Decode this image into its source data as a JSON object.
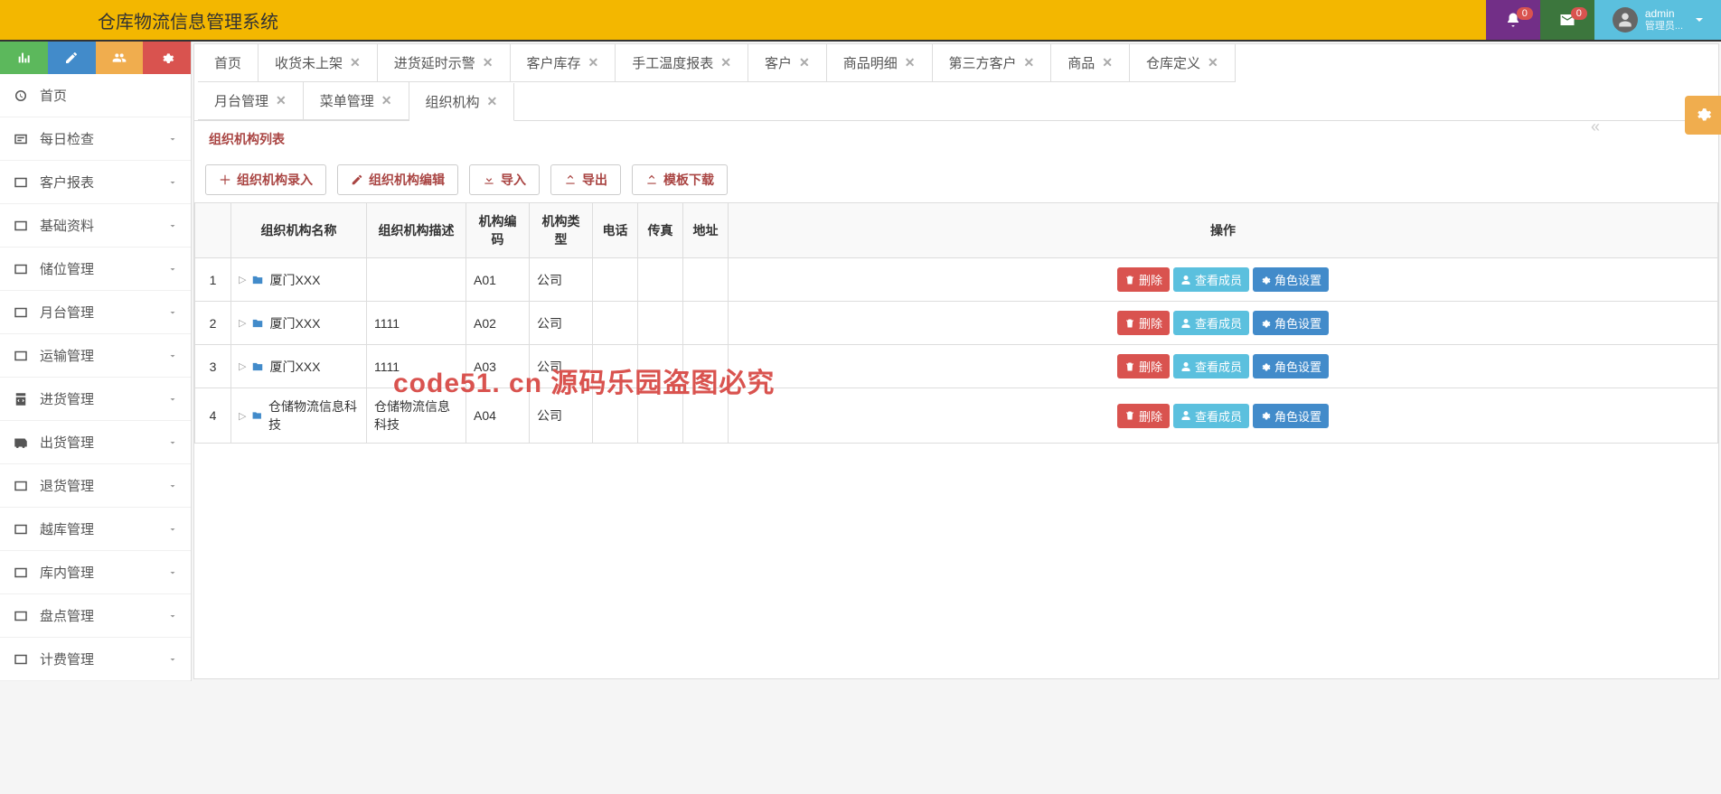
{
  "header": {
    "app_title": "仓库物流信息管理系统",
    "notif_count": "0",
    "mail_count": "0",
    "username": "admin",
    "user_role": "管理员..."
  },
  "sidebar": {
    "items": [
      {
        "label": "首页",
        "has_caret": false
      },
      {
        "label": "每日检查",
        "has_caret": true
      },
      {
        "label": "客户报表",
        "has_caret": true
      },
      {
        "label": "基础资料",
        "has_caret": true
      },
      {
        "label": "储位管理",
        "has_caret": true
      },
      {
        "label": "月台管理",
        "has_caret": true
      },
      {
        "label": "运输管理",
        "has_caret": true
      },
      {
        "label": "进货管理",
        "has_caret": true
      },
      {
        "label": "出货管理",
        "has_caret": true
      },
      {
        "label": "退货管理",
        "has_caret": true
      },
      {
        "label": "越库管理",
        "has_caret": true
      },
      {
        "label": "库内管理",
        "has_caret": true
      },
      {
        "label": "盘点管理",
        "has_caret": true
      },
      {
        "label": "计费管理",
        "has_caret": true
      }
    ]
  },
  "tabs": {
    "row1": [
      {
        "label": "首页",
        "closable": false
      },
      {
        "label": "收货未上架",
        "closable": true
      },
      {
        "label": "进货延时示警",
        "closable": true
      },
      {
        "label": "客户库存",
        "closable": true
      },
      {
        "label": "手工温度报表",
        "closable": true
      },
      {
        "label": "客户",
        "closable": true
      },
      {
        "label": "商品明细",
        "closable": true
      },
      {
        "label": "第三方客户",
        "closable": true
      },
      {
        "label": "商品",
        "closable": true
      },
      {
        "label": "仓库定义",
        "closable": true
      }
    ],
    "row2": [
      {
        "label": "月台管理",
        "closable": true
      },
      {
        "label": "菜单管理",
        "closable": true
      },
      {
        "label": "组织机构",
        "closable": true,
        "active": true
      }
    ]
  },
  "panel": {
    "title": "组织机构列表",
    "actions": {
      "add": "组织机构录入",
      "edit": "组织机构编辑",
      "import": "导入",
      "export": "导出",
      "template": "模板下载"
    },
    "columns": {
      "idx": "",
      "name": "组织机构名称",
      "desc": "组织机构描述",
      "code": "机构编码",
      "type": "机构类型",
      "phone": "电话",
      "fax": "传真",
      "addr": "地址",
      "ops": "操作"
    },
    "rows": [
      {
        "idx": "1",
        "name": "厦门XXX",
        "desc": "",
        "code": "A01",
        "type": "公司",
        "phone": "",
        "fax": "",
        "addr": ""
      },
      {
        "idx": "2",
        "name": "厦门XXX",
        "desc": "1111",
        "code": "A02",
        "type": "公司",
        "phone": "",
        "fax": "",
        "addr": ""
      },
      {
        "idx": "3",
        "name": "厦门XXX",
        "desc": "1111",
        "code": "A03",
        "type": "公司",
        "phone": "",
        "fax": "",
        "addr": ""
      },
      {
        "idx": "4",
        "name": "仓储物流信息科技",
        "desc": "仓储物流信息科技",
        "code": "A04",
        "type": "公司",
        "phone": "",
        "fax": "",
        "addr": ""
      }
    ],
    "op_labels": {
      "delete": "删除",
      "members": "查看成员",
      "role": "角色设置"
    }
  },
  "watermark": "code51. cn 源码乐园盗图必究"
}
